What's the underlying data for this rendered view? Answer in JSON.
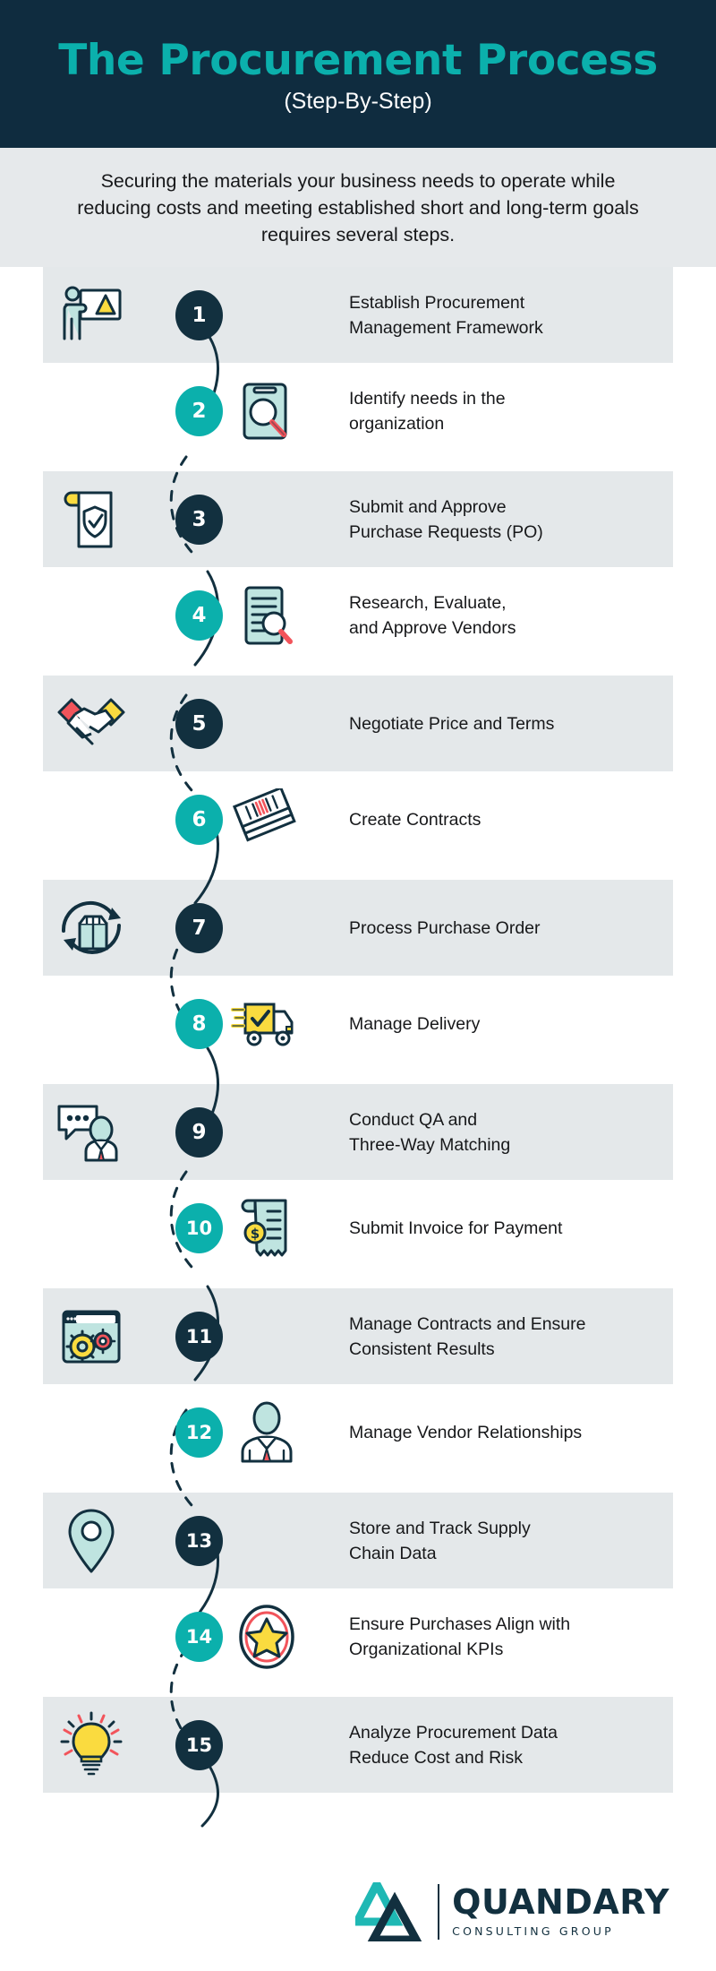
{
  "header": {
    "title": "The Procurement Process",
    "subtitle": "(Step-By-Step)",
    "title_color": "#0bb0ac",
    "background_color": "#0f2c3f"
  },
  "intro": {
    "text": "Securing the materials your business needs to operate while reducing costs and meeting established short and long-term goals requires several steps.",
    "background_color": "#e6e9eb"
  },
  "theme": {
    "navy": "#12303f",
    "teal": "#0bb0ac",
    "band_gray": "#e4e8ea",
    "yellow": "#fadb3f",
    "red": "#f2545b",
    "mint": "#bfe4e0"
  },
  "steps": [
    {
      "number": "1",
      "label": "Establish Procurement Management Framework",
      "icon": "presenter-board-icon",
      "style": "gray"
    },
    {
      "number": "2",
      "label": "Identify needs in the organization",
      "icon": "clipboard-magnifier-icon",
      "style": "white"
    },
    {
      "number": "3",
      "label": "Submit and Approve Purchase Requests (PO)",
      "icon": "document-shield-check-icon",
      "style": "gray"
    },
    {
      "number": "4",
      "label": "Research, Evaluate, and Approve Vendors",
      "icon": "document-search-icon",
      "style": "white"
    },
    {
      "number": "5",
      "label": "Negotiate Price and Terms",
      "icon": "handshake-icon",
      "style": "gray"
    },
    {
      "number": "6",
      "label": "Create Contracts",
      "icon": "contract-stack-icon",
      "style": "white"
    },
    {
      "number": "7",
      "label": "Process Purchase Order",
      "icon": "box-refresh-icon",
      "style": "gray"
    },
    {
      "number": "8",
      "label": "Manage Delivery",
      "icon": "delivery-truck-icon",
      "style": "white"
    },
    {
      "number": "9",
      "label": "Conduct QA and Three-Way Matching",
      "icon": "person-chat-icon",
      "style": "gray"
    },
    {
      "number": "10",
      "label": "Submit Invoice for Payment",
      "icon": "invoice-dollar-icon",
      "style": "white"
    },
    {
      "number": "11",
      "label": "Manage Contracts and Ensure Consistent Results",
      "icon": "browser-gears-icon",
      "style": "gray"
    },
    {
      "number": "12",
      "label": "Manage Vendor Relationships",
      "icon": "businessperson-icon",
      "style": "white"
    },
    {
      "number": "13",
      "label": "Store and Track Supply Chain Data",
      "icon": "map-pin-icon",
      "style": "gray"
    },
    {
      "number": "14",
      "label": "Ensure Purchases Align with Organizational KPIs",
      "icon": "star-badge-icon",
      "style": "white"
    },
    {
      "number": "15",
      "label": "Analyze Procurement Data Reduce Cost and Risk",
      "icon": "lightbulb-icon",
      "style": "gray"
    }
  ],
  "step_labels_multiline": [
    [
      "Establish Procurement",
      "Management Framework"
    ],
    [
      "Identify needs in the",
      "organization"
    ],
    [
      "Submit and Approve",
      "Purchase Requests (PO)"
    ],
    [
      "Research, Evaluate,",
      "and Approve Vendors"
    ],
    [
      "Negotiate Price and Terms"
    ],
    [
      "Create Contracts"
    ],
    [
      "Process Purchase Order"
    ],
    [
      "Manage Delivery"
    ],
    [
      "Conduct QA and",
      "Three-Way Matching"
    ],
    [
      "Submit Invoice for Payment"
    ],
    [
      "Manage Contracts and Ensure",
      "Consistent Results"
    ],
    [
      "Manage Vendor Relationships"
    ],
    [
      "Store and Track Supply",
      "Chain Data"
    ],
    [
      "Ensure Purchases Align with",
      "Organizational KPIs"
    ],
    [
      "Analyze Procurement Data",
      "Reduce Cost and Risk"
    ]
  ],
  "footer": {
    "logo_name": "QUANDARY",
    "logo_tagline": "CONSULTING GROUP"
  }
}
